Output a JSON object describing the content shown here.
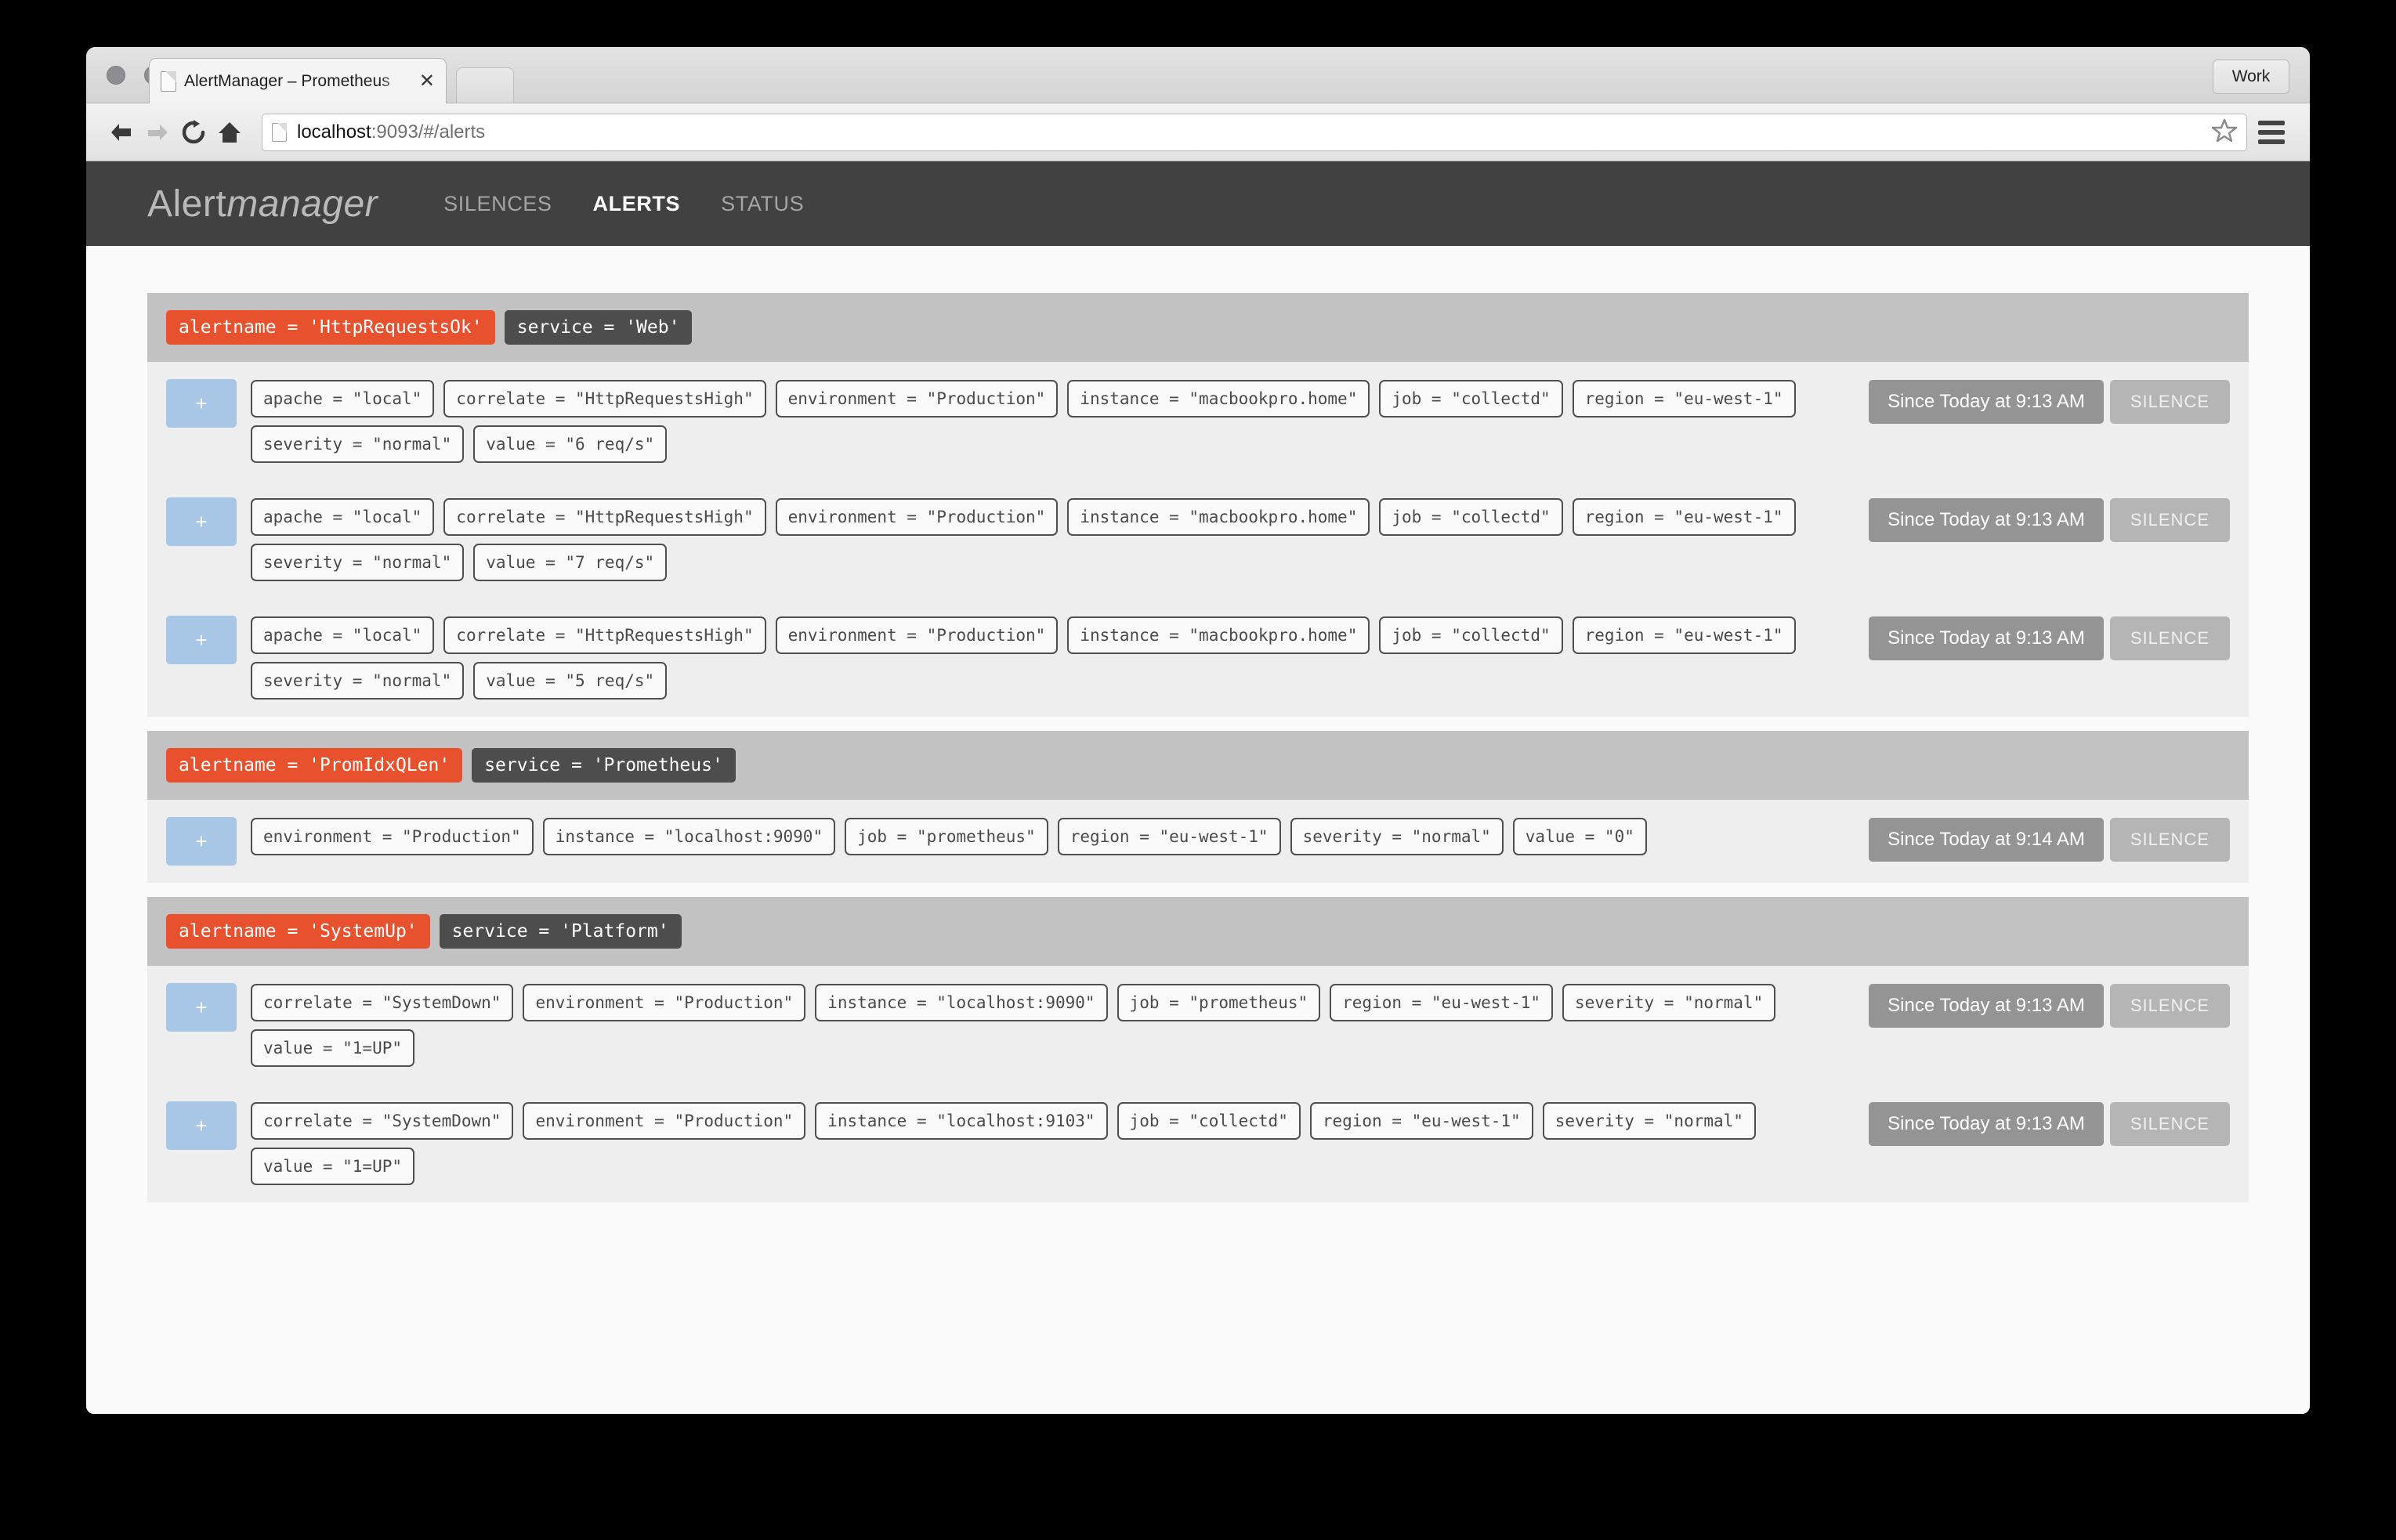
{
  "browser": {
    "tab": {
      "title": "AlertManager – Prometheus",
      "close_label": "✕"
    },
    "profile_label": "Work",
    "url": {
      "host": "localhost",
      "rest": ":9093/#/alerts"
    },
    "icons": {
      "back": "back-arrow-icon",
      "forward": "forward-arrow-icon",
      "reload": "reload-icon",
      "home": "home-icon",
      "bookmark": "star-icon",
      "menu": "hamburger-menu-icon",
      "favicon": "page-favicon-icon",
      "new_tab": "new-tab-button"
    }
  },
  "app": {
    "brand": {
      "strong": "Alert",
      "em": "manager"
    },
    "nav": [
      {
        "label": "SILENCES",
        "active": false
      },
      {
        "label": "ALERTS",
        "active": true
      },
      {
        "label": "STATUS",
        "active": false
      }
    ],
    "colors": {
      "navbar_bg": "#414141",
      "group_header_bg": "#c2c2c2",
      "alertname_badge": "#e8512e",
      "service_badge": "#4d4d4d",
      "expand_btn": "#a8c6e6",
      "since_btn": "#949494",
      "silence_btn": "#b5b5b5",
      "group_body_bg": "#eeeeee",
      "page_bg": "#fafafa"
    },
    "expand_label": "+",
    "silence_label": "SILENCE",
    "groups": [
      {
        "alertname": "alertname = 'HttpRequestsOk'",
        "service": "service = 'Web'",
        "alerts": [
          {
            "since": "Since Today at 9:13 AM",
            "labels": [
              "apache = \"local\"",
              "correlate = \"HttpRequestsHigh\"",
              "environment = \"Production\"",
              "instance = \"macbookpro.home\"",
              "job = \"collectd\"",
              "region = \"eu-west-1\"",
              "severity = \"normal\"",
              "value = \"6 req/s\""
            ]
          },
          {
            "since": "Since Today at 9:13 AM",
            "labels": [
              "apache = \"local\"",
              "correlate = \"HttpRequestsHigh\"",
              "environment = \"Production\"",
              "instance = \"macbookpro.home\"",
              "job = \"collectd\"",
              "region = \"eu-west-1\"",
              "severity = \"normal\"",
              "value = \"7 req/s\""
            ]
          },
          {
            "since": "Since Today at 9:13 AM",
            "labels": [
              "apache = \"local\"",
              "correlate = \"HttpRequestsHigh\"",
              "environment = \"Production\"",
              "instance = \"macbookpro.home\"",
              "job = \"collectd\"",
              "region = \"eu-west-1\"",
              "severity = \"normal\"",
              "value = \"5 req/s\""
            ]
          }
        ]
      },
      {
        "alertname": "alertname = 'PromIdxQLen'",
        "service": "service = 'Prometheus'",
        "alerts": [
          {
            "since": "Since Today at 9:14 AM",
            "labels": [
              "environment = \"Production\"",
              "instance = \"localhost:9090\"",
              "job = \"prometheus\"",
              "region = \"eu-west-1\"",
              "severity = \"normal\"",
              "value = \"0\""
            ]
          }
        ]
      },
      {
        "alertname": "alertname = 'SystemUp'",
        "service": "service = 'Platform'",
        "alerts": [
          {
            "since": "Since Today at 9:13 AM",
            "labels": [
              "correlate = \"SystemDown\"",
              "environment = \"Production\"",
              "instance = \"localhost:9090\"",
              "job = \"prometheus\"",
              "region = \"eu-west-1\"",
              "severity = \"normal\"",
              "value = \"1=UP\""
            ]
          },
          {
            "since": "Since Today at 9:13 AM",
            "labels": [
              "correlate = \"SystemDown\"",
              "environment = \"Production\"",
              "instance = \"localhost:9103\"",
              "job = \"collectd\"",
              "region = \"eu-west-1\"",
              "severity = \"normal\"",
              "value = \"1=UP\""
            ]
          }
        ]
      }
    ]
  }
}
